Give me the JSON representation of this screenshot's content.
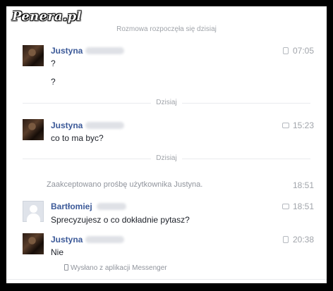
{
  "watermark": "Penera.pl",
  "conversation_started": "Rozmowa rozpoczęła się dzisiaj",
  "messages": [
    {
      "sender": "Justyna",
      "lines": [
        "?",
        "?"
      ],
      "time": "07:05",
      "via": "phone",
      "avatar": "photo"
    },
    {
      "sender": "Justyna",
      "lines": [
        "co to ma byc?"
      ],
      "time": "15:23",
      "via": "chat",
      "avatar": "photo"
    },
    {
      "sender": "Bartłomiej",
      "lines": [
        "Sprecyzujesz o co dokładnie pytasz?"
      ],
      "time": "18:51",
      "via": "chat",
      "avatar": "blank"
    },
    {
      "sender": "Justyna",
      "lines": [
        "Nie"
      ],
      "time": "20:38",
      "via": "phone",
      "avatar": "photo"
    }
  ],
  "dividers": [
    "Dzisiaj",
    "Dzisiaj"
  ],
  "system_event": {
    "text": "Zaakceptowano prośbę użytkownika Justyna.",
    "time": "18:51"
  },
  "sent_via": "Wysłano z aplikacji Messenger",
  "colors": {
    "sender": "#3b5998",
    "meta": "#a0a4aa",
    "text": "#1d2129",
    "frame": "#000000"
  }
}
